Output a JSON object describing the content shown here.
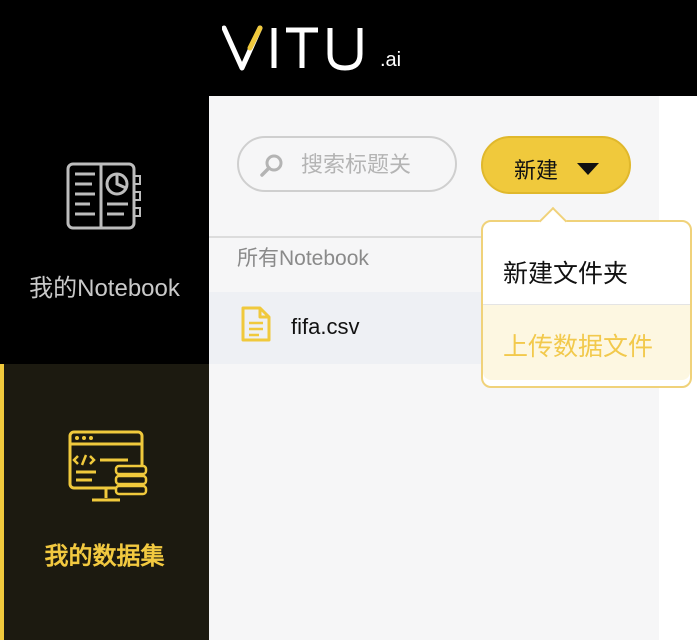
{
  "brand": {
    "logo_text": "VITU",
    "logo_suffix": ".ai",
    "accent_color": "#f0c93c"
  },
  "sidebar": {
    "items": [
      {
        "label": "我的Notebook",
        "icon": "notebook-icon",
        "active": false
      },
      {
        "label": "我的数据集",
        "icon": "dataset-icon",
        "active": true
      }
    ]
  },
  "main": {
    "search": {
      "placeholder": "搜索标题关",
      "value": ""
    },
    "new_button": {
      "label": "新建"
    },
    "section_title": "所有Notebook",
    "files": [
      {
        "name": "fifa.csv",
        "icon": "file-icon"
      }
    ]
  },
  "dropdown": {
    "items": [
      {
        "label": "新建文件夹"
      },
      {
        "label": "上传数据文件",
        "highlighted": true
      }
    ]
  }
}
